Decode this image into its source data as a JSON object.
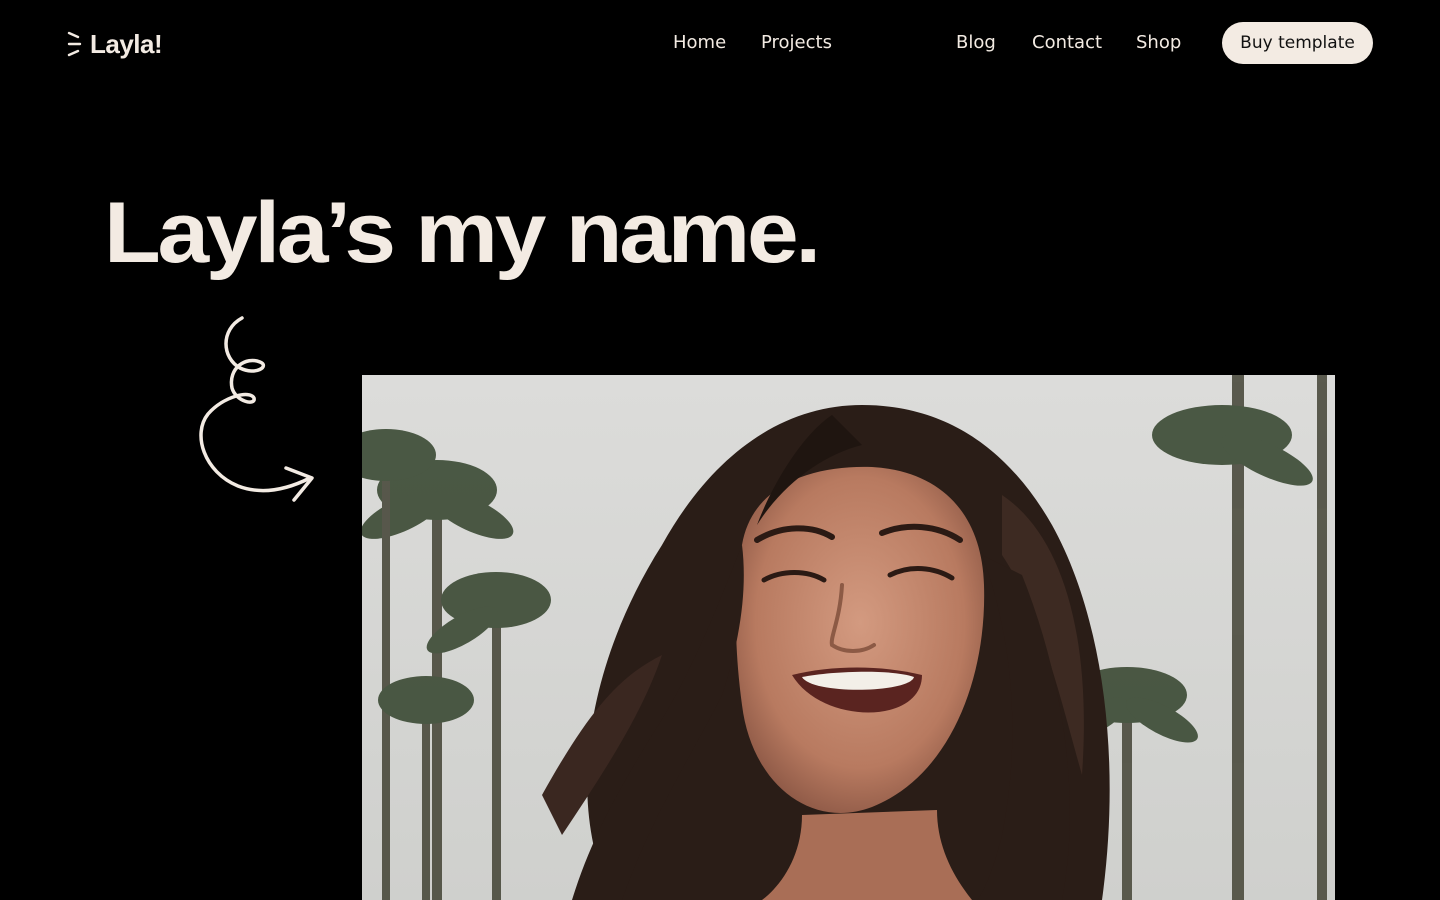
{
  "header": {
    "logo_text": "Layla!",
    "nav": {
      "home": "Home",
      "projects": "Projects",
      "blog": "Blog",
      "contact": "Contact",
      "shop": "Shop"
    },
    "buy_button": "Buy template"
  },
  "hero": {
    "title": "Layla’s my name.",
    "arrow_icon": "swirl-arrow-icon",
    "photo_alt": "smiling woman with palm trees"
  },
  "colors": {
    "background": "#000000",
    "text": "#f3ebe3",
    "button_bg": "#f3ebe3",
    "button_text": "#111111"
  }
}
